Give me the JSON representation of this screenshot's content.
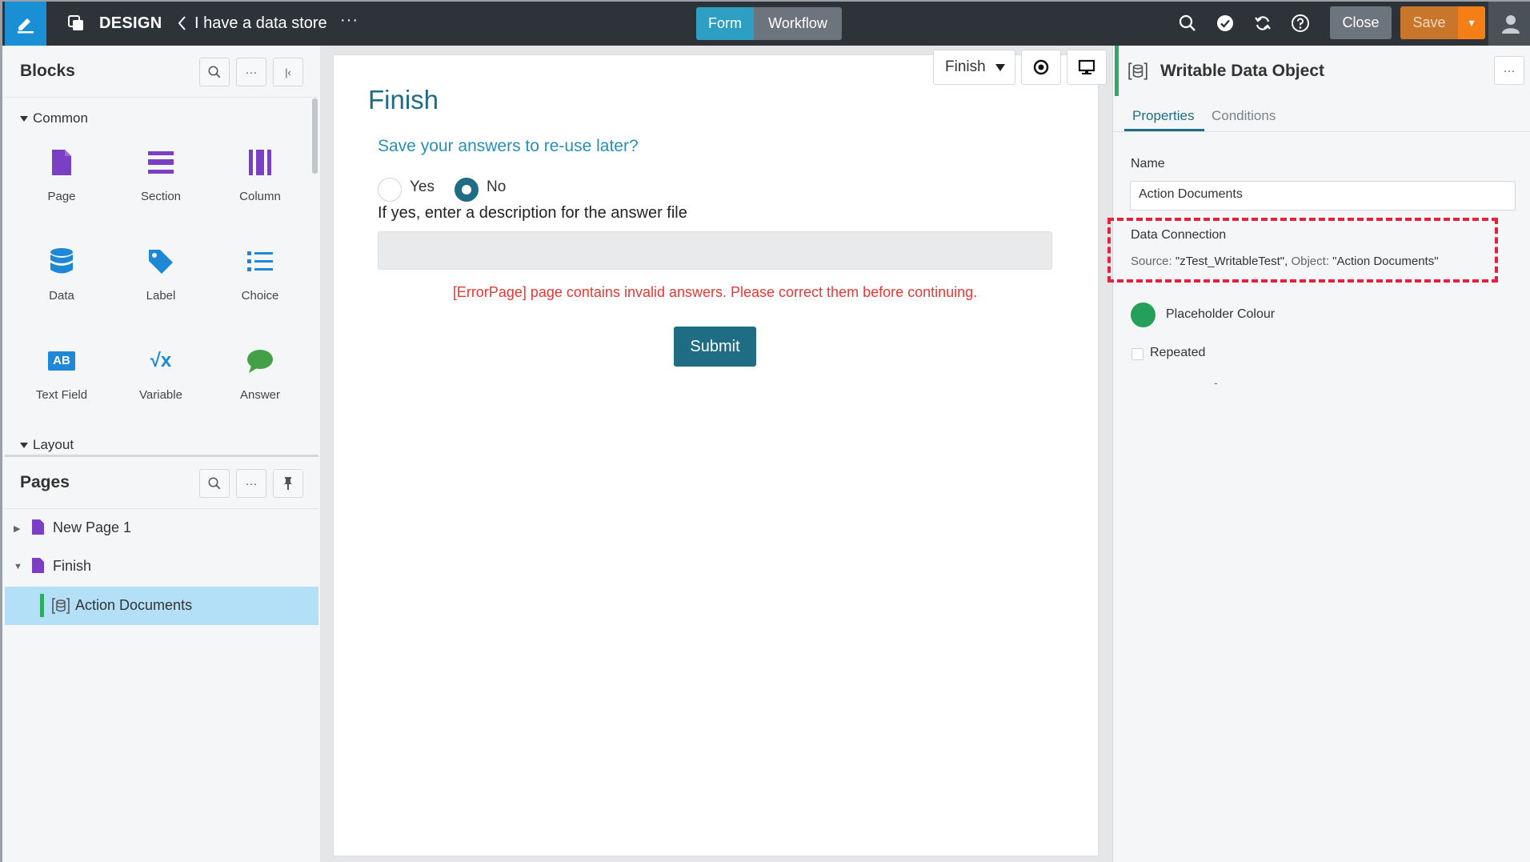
{
  "topbar": {
    "app_title": "DESIGN",
    "form_title": "I have a data store",
    "more_label": "···",
    "mode_tabs": {
      "form": "Form",
      "workflow": "Workflow"
    },
    "close_label": "Close",
    "save_label": "Save",
    "save_dropdown_glyph": "▾",
    "icons": [
      "search-icon",
      "check-circle-icon",
      "sync-icon",
      "help-icon",
      "user-icon"
    ]
  },
  "blocks_panel": {
    "title": "Blocks",
    "more_label": "···",
    "collapse_glyph": "|‹",
    "common_label": "Common",
    "items": [
      {
        "label": "Page",
        "icon": "page-icon"
      },
      {
        "label": "Section",
        "icon": "section-icon"
      },
      {
        "label": "Column",
        "icon": "column-icon"
      },
      {
        "label": "Data",
        "icon": "database-icon"
      },
      {
        "label": "Label",
        "icon": "tag-icon"
      },
      {
        "label": "Choice",
        "icon": "list-icon"
      },
      {
        "label": "Text Field",
        "icon": "text-field-icon",
        "icon_text": "AB"
      },
      {
        "label": "Variable",
        "icon": "variable-icon",
        "icon_text": "√x"
      },
      {
        "label": "Answer",
        "icon": "chat-bubble-icon"
      }
    ],
    "layout_label": "Layout"
  },
  "pages_panel": {
    "title": "Pages",
    "more_label": "···",
    "tree": [
      {
        "label": "New Page 1",
        "expanded": false
      },
      {
        "label": "Finish",
        "expanded": true
      },
      {
        "label": "Action Documents",
        "selected": true
      }
    ]
  },
  "canvas": {
    "page_select": "Finish",
    "title": "Finish",
    "question": "Save your answers to re-use later?",
    "options": {
      "yes": "Yes",
      "no": "No",
      "selected": "No"
    },
    "desc_label": "If yes, enter a description for the answer file",
    "error": "[ErrorPage] page contains invalid answers. Please correct them before continuing.",
    "submit": "Submit"
  },
  "properties": {
    "title": "Writable Data Object",
    "more_label": "···",
    "tabs": {
      "properties": "Properties",
      "conditions": "Conditions"
    },
    "name_label": "Name",
    "name_value": "Action Documents",
    "conn_label": "Data Connection",
    "conn_source_key": "Source:",
    "conn_source_value": "\"zTest_WritableTest\",",
    "conn_object_key": "Object:",
    "conn_object_value": "\"Action Documents\"",
    "placeholder_colour_label": "Placeholder Colour",
    "placeholder_colour": "#24a05a",
    "repeated_label": "Repeated",
    "repeated_checked": false,
    "dash": "-"
  },
  "colors": {
    "topbar": "#2d3338",
    "accent": "#1e6d85",
    "form_tab": "#2d9fc2",
    "save": "#c8762a",
    "save_dropdown": "#f57f17",
    "error": "#e53935",
    "highlight": "#e2233d",
    "selected_row": "#b3e0f7"
  }
}
